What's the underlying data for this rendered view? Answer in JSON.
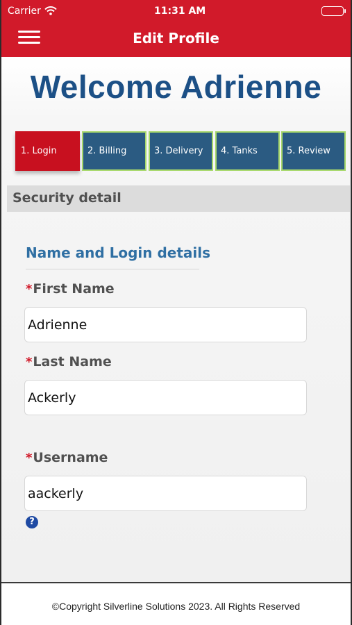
{
  "status_bar": {
    "carrier": "Carrier",
    "time": "11:31 AM"
  },
  "nav": {
    "title": "Edit Profile",
    "menu_icon": "hamburger-menu-icon"
  },
  "welcome": "Welcome Adrienne",
  "steps": [
    {
      "label": "1. Login",
      "active": true
    },
    {
      "label": "2. Billing",
      "active": false
    },
    {
      "label": "3. Delivery",
      "active": false
    },
    {
      "label": "4. Tanks",
      "active": false
    },
    {
      "label": "5. Review",
      "active": false
    }
  ],
  "section": {
    "title": "Security detail"
  },
  "subsection": {
    "title": "Name and Login details"
  },
  "form": {
    "required_marker": "*",
    "first_name": {
      "label": "First Name",
      "value": "Adrienne"
    },
    "last_name": {
      "label": "Last Name",
      "value": "Ackerly"
    },
    "username": {
      "label": "Username",
      "value": "aackerly"
    },
    "help_icon": "?"
  },
  "footer": {
    "text": "©Copyright Silverline Solutions 2023. All Rights Reserved"
  },
  "colors": {
    "brand_red": "#d11a2a",
    "step_blue": "#2b5b82",
    "step_border": "#a7d86b",
    "heading_blue": "#1c5086"
  }
}
